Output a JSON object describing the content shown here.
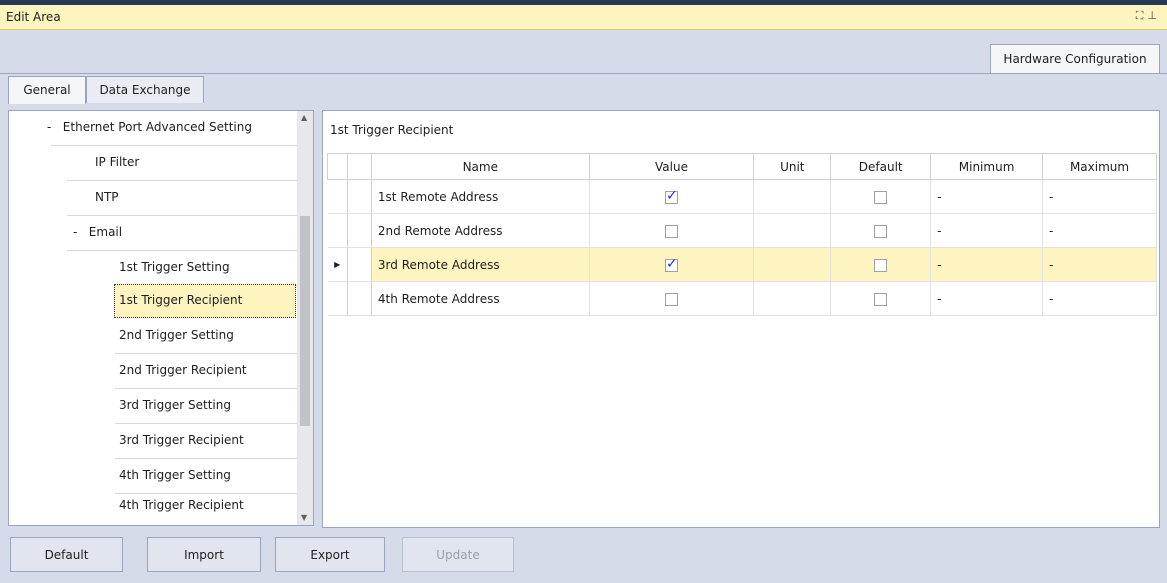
{
  "title_bar": {
    "title": "Edit Area",
    "icons": [
      "restore-icon",
      "pin-icon"
    ]
  },
  "top_tab": {
    "label": "Hardware Configuration"
  },
  "sub_tabs": [
    {
      "label": "General",
      "active": true
    },
    {
      "label": "Data Exchange",
      "active": false
    }
  ],
  "tree": {
    "items": [
      {
        "label": "Ethernet Port Advanced Setting",
        "prefix": "-"
      },
      {
        "label": "IP Filter"
      },
      {
        "label": "NTP"
      },
      {
        "label": "Email",
        "prefix": "-"
      },
      {
        "label": "1st Trigger Setting"
      },
      {
        "label": "1st Trigger Recipient",
        "selected": true
      },
      {
        "label": "2nd Trigger Setting"
      },
      {
        "label": "2nd Trigger Recipient"
      },
      {
        "label": "3rd Trigger Setting"
      },
      {
        "label": "3rd Trigger Recipient"
      },
      {
        "label": "4th Trigger Setting"
      },
      {
        "label": "4th Trigger Recipient"
      }
    ]
  },
  "panel": {
    "title": "1st Trigger Recipient",
    "columns": [
      "Name",
      "Value",
      "Unit",
      "Default",
      "Minimum",
      "Maximum"
    ],
    "rows": [
      {
        "name": "1st Remote Address",
        "value_checked": true,
        "unit": "",
        "default_checked": false,
        "minimum": "-",
        "maximum": "-"
      },
      {
        "name": "2nd Remote Address",
        "value_checked": false,
        "unit": "",
        "default_checked": false,
        "minimum": "-",
        "maximum": "-"
      },
      {
        "name": "3rd Remote Address",
        "value_checked": true,
        "unit": "",
        "default_checked": false,
        "minimum": "-",
        "maximum": "-",
        "current": true
      },
      {
        "name": "4th Remote Address",
        "value_checked": false,
        "unit": "",
        "default_checked": false,
        "minimum": "-",
        "maximum": "-"
      }
    ]
  },
  "buttons": {
    "default": "Default",
    "import": "Import",
    "export": "Export",
    "update": "Update"
  },
  "colors": {
    "title_bar": "#fdf4bf",
    "selection": "#fdf4bf",
    "background": "#d6dbe9",
    "check": "#2b2fcc"
  }
}
